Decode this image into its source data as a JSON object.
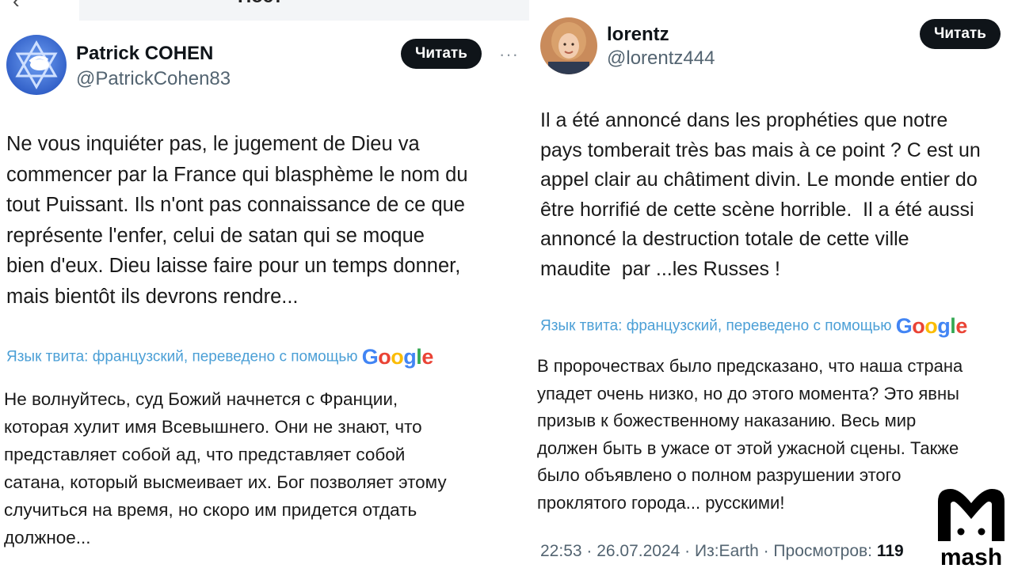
{
  "left_post": {
    "header_title": "Пост",
    "author_name": "Patrick COHEN",
    "author_handle": "@PatrickCohen83",
    "follow_label": "Читать",
    "more_label": "···",
    "text": "Ne vous inquiéter pas, le jugement de Dieu va\ncommencer par la France qui blasphème le nom du\ntout Puissant. Ils n'ont pas connaissance de ce que\nreprésente l'enfer, celui de satan qui se moque\nbien d'eux. Dieu laisse faire pour un temps donner,\nmais bientôt ils devrons rendre...",
    "translate_note": "Язык твита: французский, переведено с помощью",
    "translate_provider": "Google",
    "translation": "Не волнуйтесь, суд Божий начнется с Франции,\nкоторая хулит имя Всевышнего. Они не знают, что\nпредставляет собой ад, что представляет собой\nсатана, который высмеивает их. Бог позволяет этому\nслучиться на время, но скоро им придется отдать\nдолжное..."
  },
  "right_post": {
    "author_name": "lorentz",
    "author_handle": "@lorentz444",
    "follow_label": "Читать",
    "text": "Il a été annoncé dans les prophéties que notre\npays tomberait très bas mais à ce point ? C est un\nappel clair au châtiment divin. Le monde entier do\nêtre horrifié de cette scène horrible.  Il a été aussi\nannoncé la destruction totale de cette ville\nmaudite  par ...les Russes !",
    "translate_note": "Язык твита: французский, переведено с помощью",
    "translate_provider": "Google",
    "translation": "В пророчествах было предсказано, что наша страна\nупадет очень низко, но до этого момента? Это явны\nпризыв к божественному наказанию. Весь мир\nдолжен быть в ужасе от этой ужасной сцены. Также\nбыло объявлено о полном разрушении этого\nпроклятого города... русскими!",
    "timestamp": "22:53 · 26.07.2024",
    "source": "Из:Earth",
    "views_label": "Просмотров:",
    "views_count": "119"
  },
  "watermark": {
    "brand": "mash",
    "colors": {
      "google_blue": "#4285F4",
      "google_red": "#EA4335",
      "google_yellow": "#FBBC05",
      "google_green": "#34A853"
    }
  }
}
